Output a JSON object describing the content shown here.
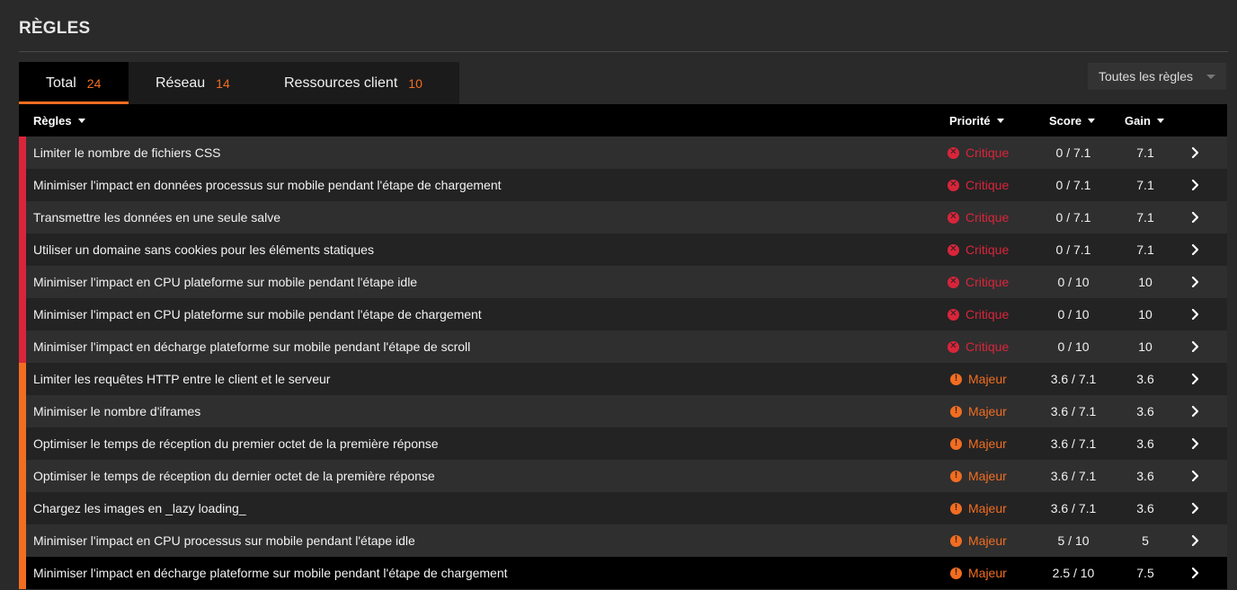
{
  "page": {
    "title": "RÈGLES"
  },
  "tabs": [
    {
      "label": "Total",
      "count": "24"
    },
    {
      "label": "Réseau",
      "count": "14"
    },
    {
      "label": "Ressources client",
      "count": "10"
    }
  ],
  "filter": {
    "selected": "Toutes les règles"
  },
  "colors": {
    "critique": "#d9253a",
    "majeur": "#f26d21",
    "accent": "#f26d21"
  },
  "table": {
    "headers": {
      "rule": "Règles",
      "priority": "Priorité",
      "score": "Score",
      "gain": "Gain"
    },
    "rows": [
      {
        "name": "Limiter le nombre de fichiers CSS",
        "priority": "Critique",
        "level": "critique",
        "score": "0 / 7.1",
        "gain": "7.1"
      },
      {
        "name": "Minimiser l'impact en données processus sur mobile pendant l'étape de chargement",
        "priority": "Critique",
        "level": "critique",
        "score": "0 / 7.1",
        "gain": "7.1"
      },
      {
        "name": "Transmettre les données en une seule salve",
        "priority": "Critique",
        "level": "critique",
        "score": "0 / 7.1",
        "gain": "7.1"
      },
      {
        "name": "Utiliser un domaine sans cookies pour les éléments statiques",
        "priority": "Critique",
        "level": "critique",
        "score": "0 / 7.1",
        "gain": "7.1"
      },
      {
        "name": "Minimiser l'impact en CPU plateforme sur mobile pendant l'étape idle",
        "priority": "Critique",
        "level": "critique",
        "score": "0 / 10",
        "gain": "10"
      },
      {
        "name": "Minimiser l'impact en CPU plateforme sur mobile pendant l'étape de chargement",
        "priority": "Critique",
        "level": "critique",
        "score": "0 / 10",
        "gain": "10"
      },
      {
        "name": "Minimiser l'impact en décharge plateforme sur mobile pendant l'étape de scroll",
        "priority": "Critique",
        "level": "critique",
        "score": "0 / 10",
        "gain": "10"
      },
      {
        "name": "Limiter les requêtes HTTP entre le client et le serveur",
        "priority": "Majeur",
        "level": "majeur",
        "score": "3.6 / 7.1",
        "gain": "3.6"
      },
      {
        "name": "Minimiser le nombre d'iframes",
        "priority": "Majeur",
        "level": "majeur",
        "score": "3.6 / 7.1",
        "gain": "3.6"
      },
      {
        "name": "Optimiser le temps de réception du premier octet de la première réponse",
        "priority": "Majeur",
        "level": "majeur",
        "score": "3.6 / 7.1",
        "gain": "3.6"
      },
      {
        "name": "Optimiser le temps de réception du dernier octet de la première réponse",
        "priority": "Majeur",
        "level": "majeur",
        "score": "3.6 / 7.1",
        "gain": "3.6"
      },
      {
        "name": "Chargez les images en _lazy loading_",
        "priority": "Majeur",
        "level": "majeur",
        "score": "3.6 / 7.1",
        "gain": "3.6"
      },
      {
        "name": "Minimiser l'impact en CPU processus sur mobile pendant l'étape idle",
        "priority": "Majeur",
        "level": "majeur",
        "score": "5 / 10",
        "gain": "5"
      },
      {
        "name": "Minimiser l'impact en décharge plateforme sur mobile pendant l'étape de chargement",
        "priority": "Majeur",
        "level": "majeur",
        "score": "2.5 / 10",
        "gain": "7.5"
      }
    ]
  }
}
